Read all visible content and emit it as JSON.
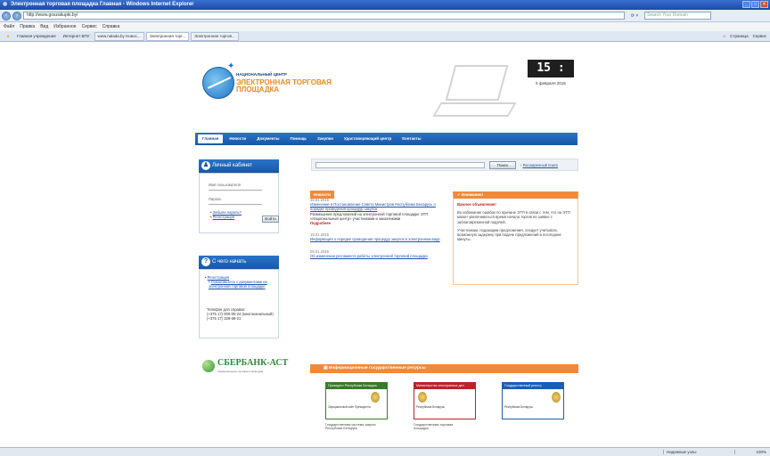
{
  "window": {
    "title": "Электронная торговая площадка Главная - Windows Internet Explorer"
  },
  "addressbar": {
    "url": "http://www.goszakupki.by/",
    "search_placeholder": "Search Your Domain"
  },
  "menubar": [
    "Файл",
    "Правка",
    "Вид",
    "Избранное",
    "Сервис",
    "Справка"
  ],
  "favorites": {
    "items": [
      "Главная учреждения",
      "Интернет БПУ"
    ]
  },
  "tabs": [
    {
      "label": "www.nalada.by Новос...",
      "active": false
    },
    {
      "label": "Электронная торг...",
      "active": true
    },
    {
      "label": "Электронная торгов...",
      "active": false
    }
  ],
  "tabtools": [
    "Страница",
    "Сервис"
  ],
  "site": {
    "logo_line1": "НАЦИОНАЛЬНЫЙ ЦЕНТР",
    "logo_line2": "ЭЛЕКТРОННАЯ ТОРГОВАЯ",
    "logo_line3": "ПЛОЩАДКА",
    "clock": "15 : 58",
    "date": "6 февраля 2015",
    "nav": [
      "Главная",
      "Новости",
      "Документы",
      "Помощь",
      "Закупки",
      "Удостоверяющий центр",
      "Контакты"
    ]
  },
  "cabinet": {
    "title": "Личный кабинет",
    "login_label": "Имя пользователя",
    "password_label": "Пароль",
    "links": [
      "Забыли пароль?",
      "Регистрация"
    ],
    "login_button": "Войти"
  },
  "howto": {
    "title": "С чего начать",
    "links": [
      "Регистрация",
      "Ознакомьтесь с документами на электронной торговой площадке"
    ],
    "phone_label": "Телефон для справок:",
    "phone1": "(+375 17) 000-00-24 (многоканальный)",
    "phone2": "(+375 17) 328-68-21"
  },
  "sberbank": {
    "name": "СБЕРБАНК-АСТ",
    "sub": "Универсальная торговая платформа"
  },
  "search": {
    "button": "Поиск",
    "advanced": "Расширенный поиск"
  },
  "news": {
    "tab": "Новости",
    "items": [
      {
        "date": "26.01.2015",
        "link": "Изменение в Постановление Совета Министров Республики Беларусь о порядке проведения процедур закупок",
        "text": "Размещение предложений на электронной торговой площадке ЭТП «Национальный центр» участниками и заказчиками",
        "tail": "Подробнее"
      },
      {
        "date": "19.01.2015",
        "link": "Информация о порядке проведения процедур закупок в электронном виде"
      },
      {
        "date": "09.01.2015",
        "link": "Об изменении регламента работы электронной торговой площадки"
      }
    ]
  },
  "attention": {
    "title": "Внимание!",
    "heading": "Важное объявление!",
    "p1": "Во избежание ошибок по причине ЭТП в связи с тем, что на ЭТП может увеличиваться время начала торгов по заявке с заблаговременной подачей.",
    "p2": "Участникам, подающим предложения, следует учитывать возможную задержку при подаче предложений в последние минуты."
  },
  "partners": {
    "title": "Информационные государственные ресурсы",
    "boxes": [
      {
        "head": "Президент Республики Беларусь",
        "color": "#3a7a2a",
        "caption": "Официальный сайт Президента"
      },
      {
        "head": "Министерство иностранных дел",
        "color": "#b8232a",
        "caption": "Республика Беларусь"
      },
      {
        "head": "Государственный реестр",
        "color": "#1d5db0",
        "caption": "Республика Беларусь"
      }
    ],
    "bottom": [
      "Государственная система закупок Республики Беларусь",
      "Государственная торговая площадка"
    ]
  },
  "status": {
    "zone": "Надежные узлы",
    "zoom": "100%"
  }
}
